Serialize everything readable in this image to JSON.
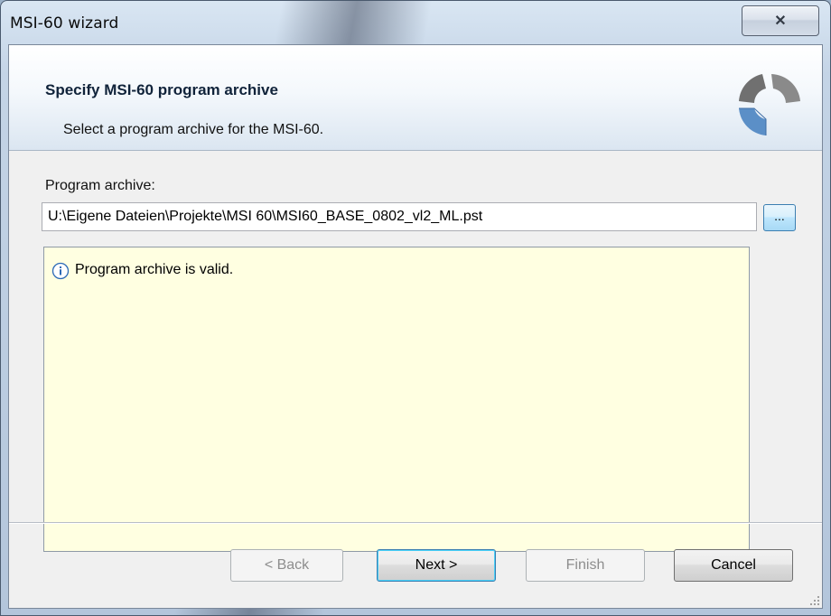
{
  "window": {
    "title": "MSI-60 wizard",
    "close_symbol": "✕"
  },
  "header": {
    "title": "Specify MSI-60 program archive",
    "subtitle": "Select a program archive for the MSI-60.",
    "logo_icon": "ring-segments-logo"
  },
  "form": {
    "archive_label": "Program archive:",
    "archive_path": "U:\\Eigene Dateien\\Projekte\\MSI 60\\MSI60_BASE_0802_vl2_ML.pst",
    "browse_label": "..."
  },
  "message": {
    "icon": "info-icon",
    "text": "Program archive is valid."
  },
  "buttons": {
    "back": "< Back",
    "next": "Next >",
    "finish": "Finish",
    "cancel": "Cancel"
  },
  "colors": {
    "message_bg": "#ffffe1",
    "header_title": "#10233a",
    "logo_gray": "#6d6d6d",
    "logo_blue": "#5b8fc7"
  }
}
